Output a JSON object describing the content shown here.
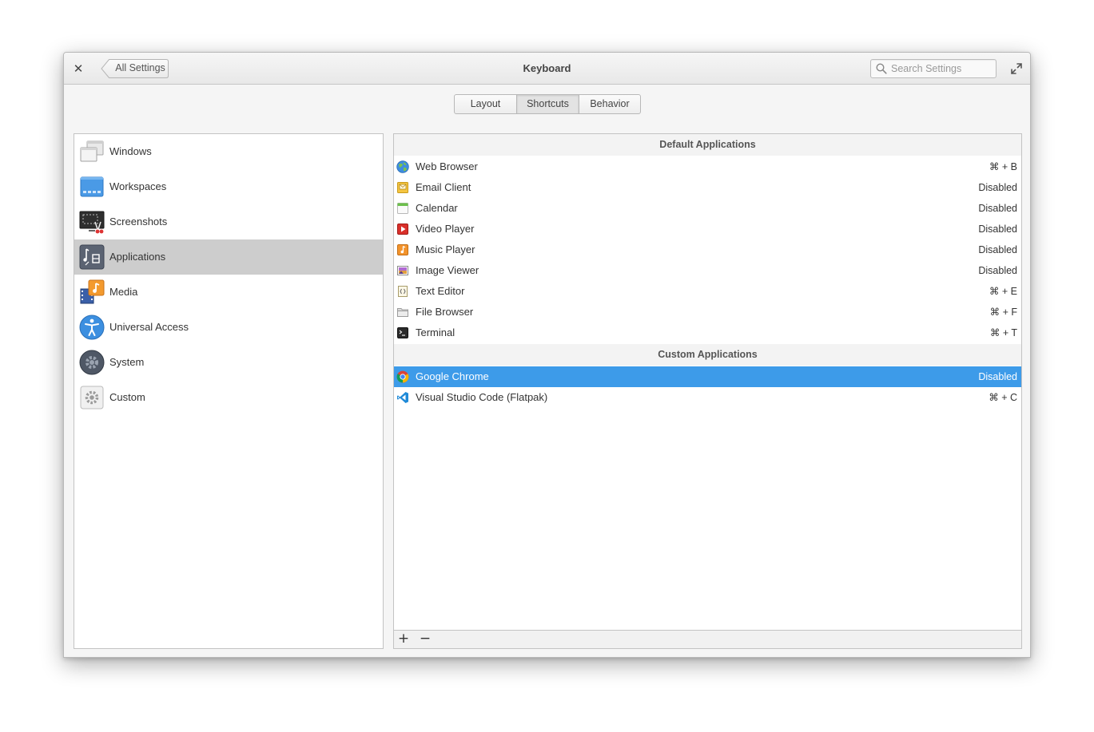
{
  "window": {
    "title": "Keyboard"
  },
  "header": {
    "close_glyph": "✕",
    "back_label": "All Settings",
    "search_placeholder": "Search Settings"
  },
  "tabs": [
    {
      "label": "Layout",
      "active": false
    },
    {
      "label": "Shortcuts",
      "active": true
    },
    {
      "label": "Behavior",
      "active": false
    }
  ],
  "sidebar": {
    "items": [
      {
        "label": "Windows",
        "icon": "windows-icon",
        "selected": false
      },
      {
        "label": "Workspaces",
        "icon": "workspaces-icon",
        "selected": false
      },
      {
        "label": "Screenshots",
        "icon": "screenshots-icon",
        "selected": false
      },
      {
        "label": "Applications",
        "icon": "applications-icon",
        "selected": true
      },
      {
        "label": "Media",
        "icon": "media-icon",
        "selected": false
      },
      {
        "label": "Universal Access",
        "icon": "universal-access-icon",
        "selected": false
      },
      {
        "label": "System",
        "icon": "system-icon",
        "selected": false
      },
      {
        "label": "Custom",
        "icon": "custom-icon",
        "selected": false
      }
    ]
  },
  "shortcuts": {
    "default_header": "Default Applications",
    "default_apps": [
      {
        "name": "Web Browser",
        "accel": "⌘ + B",
        "icon": "web-browser-icon"
      },
      {
        "name": "Email Client",
        "accel": "Disabled",
        "icon": "email-client-icon"
      },
      {
        "name": "Calendar",
        "accel": "Disabled",
        "icon": "calendar-icon"
      },
      {
        "name": "Video Player",
        "accel": "Disabled",
        "icon": "video-player-icon"
      },
      {
        "name": "Music Player",
        "accel": "Disabled",
        "icon": "music-player-icon"
      },
      {
        "name": "Image Viewer",
        "accel": "Disabled",
        "icon": "image-viewer-icon"
      },
      {
        "name": "Text Editor",
        "accel": "⌘ + E",
        "icon": "text-editor-icon"
      },
      {
        "name": "File Browser",
        "accel": "⌘ + F",
        "icon": "file-browser-icon"
      },
      {
        "name": "Terminal",
        "accel": "⌘ + T",
        "icon": "terminal-icon"
      }
    ],
    "custom_header": "Custom Applications",
    "custom_apps": [
      {
        "name": "Google Chrome",
        "accel": "Disabled",
        "icon": "google-chrome-icon",
        "selected": true
      },
      {
        "name": "Visual Studio Code (Flatpak)",
        "accel": "⌘ + C",
        "icon": "vscode-icon",
        "selected": false
      }
    ],
    "toolbar": {
      "add_glyph": "+",
      "remove_glyph": "−"
    }
  },
  "colors": {
    "selection": "#3d9be9",
    "sidebar_selected": "#cdcdcd"
  }
}
